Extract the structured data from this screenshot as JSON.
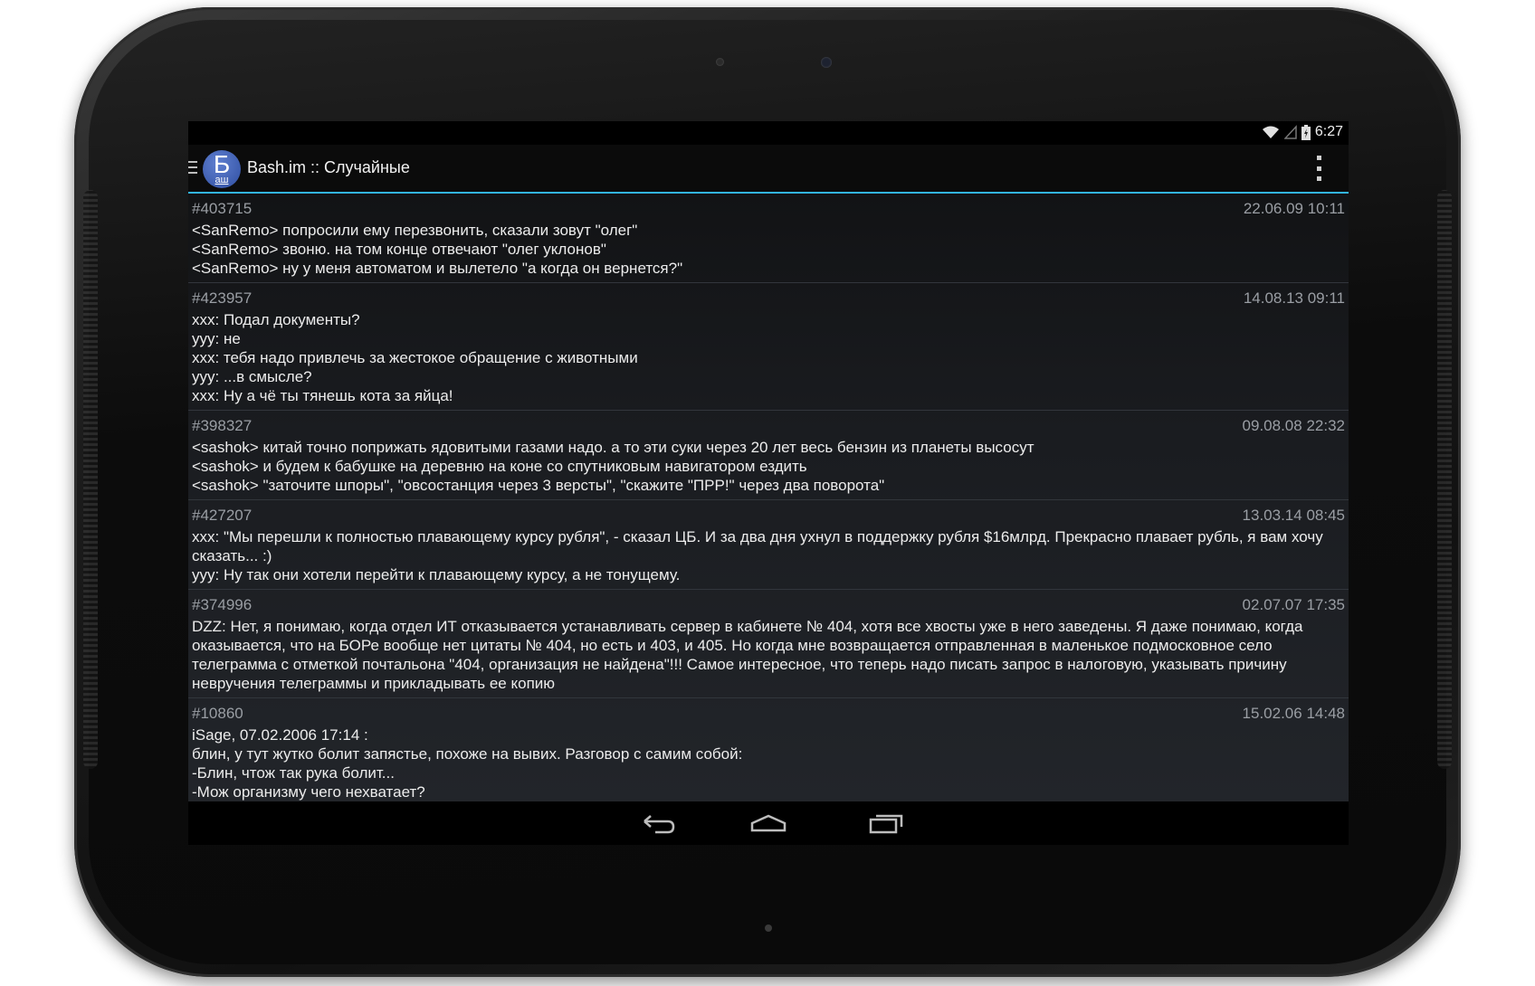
{
  "status_bar": {
    "time": "6:27"
  },
  "action_bar": {
    "logo_big": "Б",
    "logo_small": "аш",
    "title": "Bash.im :: Случайные"
  },
  "quotes": [
    {
      "id": "#403715",
      "date": "22.06.09 10:11",
      "text": "<SanRemo> попросили ему перезвонить, сказали зовут \"олег\"\n<SanRemo> звоню. на том конце отвечают \"олег уклонов\"\n<SanRemo> ну у меня автоматом и вылетело \"а когда он вернется?\""
    },
    {
      "id": "#423957",
      "date": "14.08.13 09:11",
      "text": "xxx: Подал документы?\nyyy: не\nxxx: тебя надо привлечь за жестокое обращение с животными\nyyy: ...в смысле?\nxxx: Ну а чё ты тянешь кота за яйца!"
    },
    {
      "id": "#398327",
      "date": "09.08.08 22:32",
      "text": "<sashok> китай точно поприжать ядовитыми газами надо. а то эти суки через 20 лет весь бензин из планеты высосут\n<sashok> и будем к бабушке на деревню на коне со спутниковым навигатором ездить\n<sashok> \"заточите шпоры\", \"овсостанция через 3 версты\", \"скажите \"ПРР!\" через два поворота\""
    },
    {
      "id": "#427207",
      "date": "13.03.14 08:45",
      "text": "xxx: \"Мы перешли к полностью плавающему курсу рубля\", - сказал ЦБ. И за два дня ухнул в поддержку рубля $16млрд. Прекрасно плавает рубль, я вам хочу сказать... :)\nyyy: Ну так они хотели перейти к плавающему курсу, а не тонущему."
    },
    {
      "id": "#374996",
      "date": "02.07.07 17:35",
      "text": "DZZ: Нет, я понимаю, когда отдел ИТ отказывается устанавливать сервер в кабинете № 404, хотя все хвосты уже в него заведены. Я даже понимаю, когда оказывается, что на БОРе вообще нет цитаты № 404, но есть и 403, и 405. Но когда мне возвращается отправленная в маленькое подмосковное село телеграмма с отметкой почтальона \"404, организация не найдена\"!!! Самое интересное, что теперь надо писать запрос в налоговую, указывать причину невручения телеграммы и прикладывать ее копию"
    },
    {
      "id": "#10860",
      "date": "15.02.06 14:48",
      "text": "iSage, 07.02.2006 17:14 :\nблин, у тут жутко болит запястье, похоже на вывих. Разговор с самим собой:\n-Блин, чтож так рука болит...\n-Мож организму чего нехватает?"
    }
  ],
  "icons": {
    "drawer": "drawer-icon",
    "wifi": "wifi-icon",
    "signal": "signal-icon",
    "battery": "battery-icon",
    "overflow": "overflow-menu-icon",
    "back": "back-icon",
    "home": "home-icon",
    "recents": "recents-icon"
  },
  "colors": {
    "accent": "#33b5e5",
    "logo": "#3d5db8"
  }
}
